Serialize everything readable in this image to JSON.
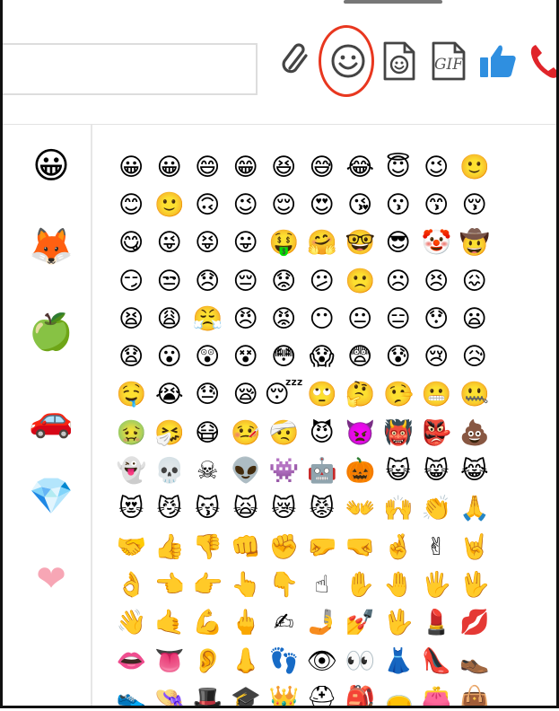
{
  "toolbar": {
    "icons": [
      "paperclip-icon",
      "smiley-icon",
      "sticker-icon",
      "gif-icon",
      "thumbs-up-icon",
      "phone-icon"
    ],
    "gif_label": "GIF",
    "accent_colors": {
      "highlight_ring": "#e8371f",
      "like_blue": "#2f8fe0",
      "phone_red": "#e0242a"
    }
  },
  "sidebar": {
    "categories": [
      {
        "name": "smileys",
        "glyph": "😀"
      },
      {
        "name": "animals",
        "glyph": "🦊"
      },
      {
        "name": "food",
        "glyph": "🍏"
      },
      {
        "name": "travel",
        "glyph": "🚗"
      },
      {
        "name": "objects",
        "glyph": "💎"
      },
      {
        "name": "symbols",
        "glyph": "❤"
      }
    ]
  },
  "emoji_grid": [
    "😀",
    "😀",
    "😄",
    "😁",
    "😆",
    "😅",
    "😂",
    "😇",
    "😉",
    "🙂",
    "😊",
    "🙂",
    "🙃",
    "😉",
    "😌",
    "😍",
    "😘",
    "😗",
    "😙",
    "😚",
    "😋",
    "😜",
    "😝",
    "😛",
    "🤑",
    "🤗",
    "🤓",
    "😎",
    "🤡",
    "🤠",
    "😏",
    "😒",
    "😞",
    "😔",
    "😟",
    "😕",
    "🙁",
    "☹",
    "😣",
    "😖",
    "😫",
    "😩",
    "😤",
    "😠",
    "😡",
    "😶",
    "😐",
    "😑",
    "😯",
    "😦",
    "😧",
    "😮",
    "😲",
    "😵",
    "😳",
    "😱",
    "😨",
    "😰",
    "😢",
    "😥",
    "🤤",
    "😭",
    "😓",
    "😪",
    "😴",
    "🙄",
    "🤔",
    "🤥",
    "😬",
    "🤐",
    "🤢",
    "🤧",
    "😷",
    "🤒",
    "🤕",
    "😈",
    "👿",
    "👹",
    "👺",
    "💩",
    "👻",
    "💀",
    "☠",
    "👽",
    "👾",
    "🤖",
    "🎃",
    "😺",
    "😸",
    "😹",
    "😻",
    "😼",
    "😽",
    "🙀",
    "😿",
    "😾",
    "👐",
    "🙌",
    "👏",
    "🙏",
    "🤝",
    "👍",
    "👎",
    "👊",
    "✊",
    "🤛",
    "🤜",
    "🤞",
    "✌",
    "🤘",
    "👌",
    "👈",
    "👉",
    "👆",
    "👇",
    "☝",
    "✋",
    "🤚",
    "🖐",
    "🖖",
    "👋",
    "🤙",
    "💪",
    "🖕",
    "✍",
    "🤳",
    "💅",
    "🖖",
    "💄",
    "💋",
    "👄",
    "👅",
    "👂",
    "👃",
    "👣",
    "👁",
    "👀",
    "👗",
    "👠",
    "👞",
    "👟",
    "👒",
    "🎩",
    "🎓",
    "👑",
    "⛑",
    "🎒",
    "👝",
    "👛",
    "👜"
  ]
}
